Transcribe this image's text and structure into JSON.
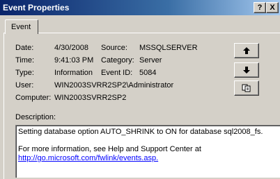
{
  "window": {
    "title": "Event Properties",
    "help_label": "?",
    "close_label": "X"
  },
  "tabs": [
    {
      "label": "Event"
    }
  ],
  "fields": {
    "date_label": "Date:",
    "date_value": "4/30/2008",
    "source_label": "Source:",
    "source_value": "MSSQLSERVER",
    "time_label": "Time:",
    "time_value": "9:41:03 PM",
    "category_label": "Category:",
    "category_value": "Server",
    "type_label": "Type:",
    "type_value": "Information",
    "event_id_label": "Event ID:",
    "event_id_value": "5084",
    "user_label": "User:",
    "user_value": "WIN2003SVRR2SP2\\Administrator",
    "computer_label": "Computer:",
    "computer_value": "WIN2003SVRR2SP2"
  },
  "side_buttons": {
    "up_icon": "up-arrow-icon",
    "down_icon": "down-arrow-icon",
    "copy_icon": "copy-icon"
  },
  "description": {
    "label": "Description:",
    "line1": "Setting database option AUTO_SHRINK to ON for database sql2008_fs.",
    "line2": "For more information, see Help and Support Center at",
    "link": "http://go.microsoft.com/fwlink/events.asp."
  }
}
